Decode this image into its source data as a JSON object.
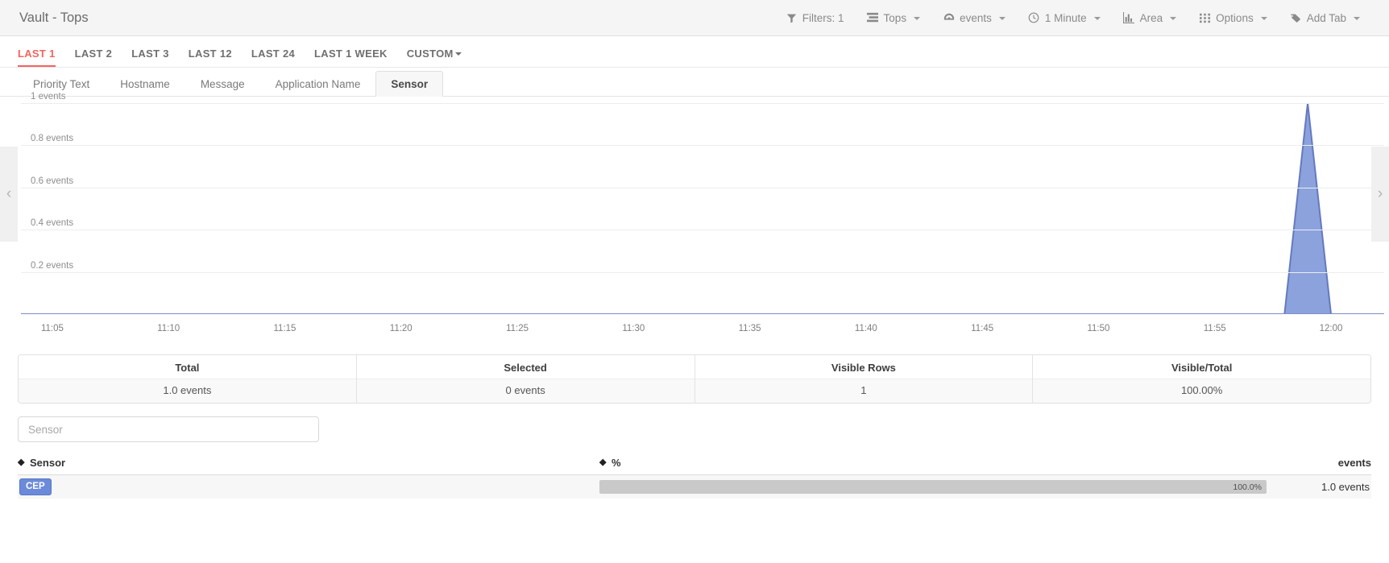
{
  "header": {
    "title": "Vault - Tops",
    "toolbar": [
      {
        "label": "Filters: 1",
        "icon": "filter-icon",
        "caret": false
      },
      {
        "label": "Tops",
        "icon": "list-icon",
        "caret": true
      },
      {
        "label": "events",
        "icon": "gauge-icon",
        "caret": true
      },
      {
        "label": "1 Minute",
        "icon": "clock-icon",
        "caret": true
      },
      {
        "label": "Area",
        "icon": "bar-chart-icon",
        "caret": true
      },
      {
        "label": "Options",
        "icon": "grid-icon",
        "caret": true
      },
      {
        "label": "Add Tab",
        "icon": "tag-icon",
        "caret": true
      }
    ]
  },
  "time_ranges": {
    "items": [
      {
        "label": "LAST 1",
        "active": true,
        "caret": false
      },
      {
        "label": "LAST 2",
        "active": false,
        "caret": false
      },
      {
        "label": "LAST 3",
        "active": false,
        "caret": false
      },
      {
        "label": "LAST 12",
        "active": false,
        "caret": false
      },
      {
        "label": "LAST 24",
        "active": false,
        "caret": false
      },
      {
        "label": "LAST 1 WEEK",
        "active": false,
        "caret": false
      },
      {
        "label": "CUSTOM",
        "active": false,
        "caret": true
      }
    ]
  },
  "field_tabs": {
    "items": [
      {
        "label": "Priority Text",
        "active": false
      },
      {
        "label": "Hostname",
        "active": false
      },
      {
        "label": "Message",
        "active": false
      },
      {
        "label": "Application Name",
        "active": false
      },
      {
        "label": "Sensor",
        "active": true
      }
    ]
  },
  "chart_data": {
    "type": "area",
    "title": "",
    "xlabel": "",
    "ylabel": "events",
    "ylim": [
      0,
      1
    ],
    "xlim": [
      "11:04",
      "12:01"
    ],
    "grid": true,
    "legend": "none",
    "y_ticks": [
      "1 events",
      "0.8 events",
      "0.6 events",
      "0.4 events",
      "0.2 events"
    ],
    "y_tick_values": [
      1,
      0.8,
      0.6,
      0.4,
      0.2
    ],
    "x_ticks": [
      "11:05",
      "11:10",
      "11:15",
      "11:20",
      "11:25",
      "11:30",
      "11:35",
      "11:40",
      "11:45",
      "11:50",
      "11:55",
      "12:00"
    ],
    "series": [
      {
        "name": "events",
        "color": "#8ba2dd",
        "line_color": "#6479c0",
        "x": [
          "11:04",
          "11:57",
          "11:58",
          "11:59",
          "12:00",
          "12:01"
        ],
        "values": [
          0,
          0,
          0,
          1,
          0,
          0
        ]
      }
    ],
    "pager_left": "‹",
    "pager_right": "›"
  },
  "stats": {
    "cells": [
      {
        "title": "Total",
        "value": "1.0 events"
      },
      {
        "title": "Selected",
        "value": "0 events"
      },
      {
        "title": "Visible Rows",
        "value": "1"
      },
      {
        "title": "Visible/Total",
        "value": "100.00%"
      }
    ]
  },
  "search": {
    "placeholder": "Sensor",
    "value": ""
  },
  "table": {
    "columns": [
      {
        "label": "Sensor",
        "sortable": true
      },
      {
        "label": "%",
        "sortable": true
      },
      {
        "label": "events",
        "sortable": false
      }
    ],
    "rows": [
      {
        "sensor": "CEP",
        "percent_label": "100.0%",
        "percent": 100,
        "events": "1.0 events"
      }
    ]
  }
}
